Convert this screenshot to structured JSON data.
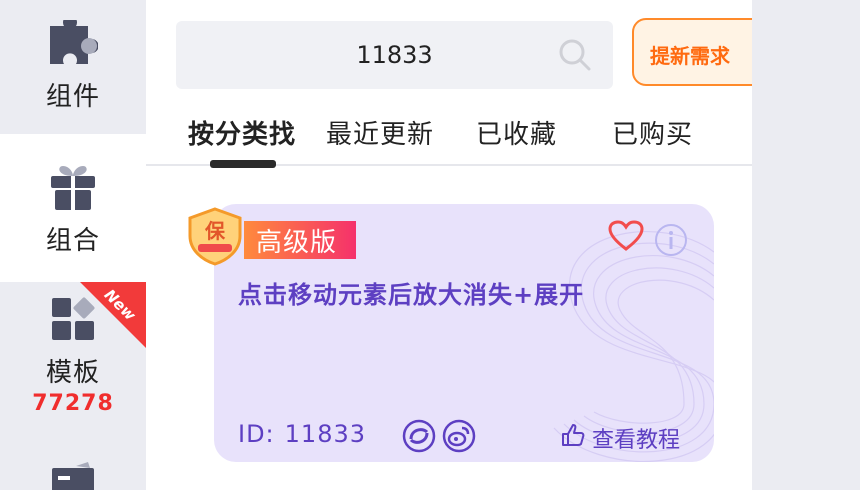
{
  "sidebar": {
    "items": [
      {
        "label": "组件",
        "icon": "puzzle-icon"
      },
      {
        "label": "组合",
        "icon": "gift-icon",
        "active": true
      },
      {
        "label": "模板",
        "icon": "template-grid-icon",
        "count": "77278",
        "ribbon": "New"
      },
      {
        "label": "",
        "icon": "folder-icon"
      }
    ]
  },
  "search": {
    "value": "11833",
    "icon": "search-icon"
  },
  "request_button": {
    "label": "提新需求"
  },
  "tabs": [
    {
      "label": "按分类找",
      "active": true
    },
    {
      "label": "最近更新"
    },
    {
      "label": "已收藏"
    },
    {
      "label": "已购买"
    }
  ],
  "card": {
    "badge": "高级版",
    "shield_text": "保",
    "title": "点击移动元素后放大消失+展开",
    "id_label": "ID:",
    "id_value": "11833",
    "tutorial": "查看教程",
    "icons": [
      "heart-icon",
      "info-icon",
      "share-icon",
      "weibo-icon",
      "hand-pointer-icon"
    ]
  },
  "colors": {
    "accent_purple": "#5d3fc2",
    "card_bg": "#e8e2fb",
    "orange": "#ff6a10",
    "red": "#f02d2d",
    "sidebar_bg": "#ebecf2"
  }
}
